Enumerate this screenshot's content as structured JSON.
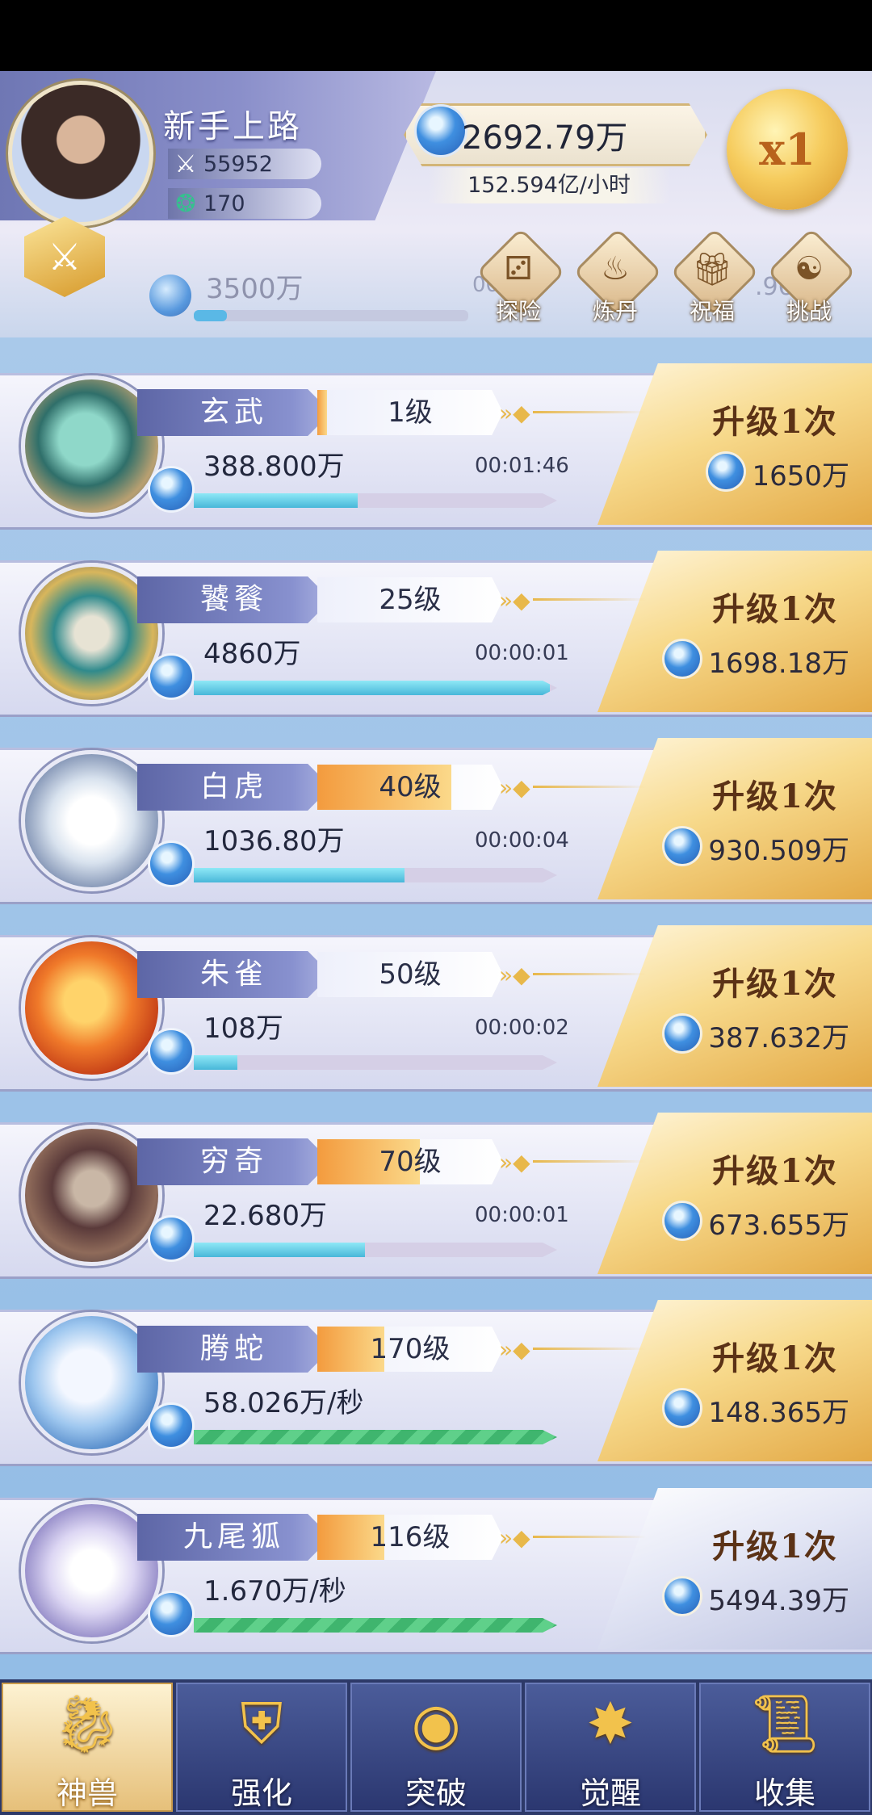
{
  "player": {
    "name": "新手上路",
    "power": "55952",
    "jade": "170",
    "coins": "2692.79万",
    "rate": "152.594亿/小时",
    "speed": "x1"
  },
  "hidden_row": {
    "amount": "3500万",
    "timer_fragment": "00:0",
    "right_fragment": ".96"
  },
  "actions": [
    {
      "label": "探险",
      "icon": "dice-icon"
    },
    {
      "label": "炼丹",
      "icon": "cauldron-icon"
    },
    {
      "label": "祝福",
      "icon": "gift-icon"
    },
    {
      "label": "挑战",
      "icon": "challenge-icon"
    }
  ],
  "beasts": [
    {
      "name": "玄武",
      "level": "1级",
      "level_progress": 0.05,
      "output": "388.800万",
      "timer": "00:01:46",
      "progress": 0.45,
      "upgrade_label": "升级1次",
      "cost": "1650万",
      "auto": false
    },
    {
      "name": "饕餮",
      "level": "25级",
      "level_progress": 0.0,
      "output": "4860万",
      "timer": "00:00:01",
      "progress": 0.98,
      "upgrade_label": "升级1次",
      "cost": "1698.18万",
      "auto": false
    },
    {
      "name": "白虎",
      "level": "40级",
      "level_progress": 0.72,
      "output": "1036.80万",
      "timer": "00:00:04",
      "progress": 0.58,
      "upgrade_label": "升级1次",
      "cost": "930.509万",
      "auto": false
    },
    {
      "name": "朱雀",
      "level": "50级",
      "level_progress": 0.0,
      "output": "108万",
      "timer": "00:00:02",
      "progress": 0.12,
      "upgrade_label": "升级1次",
      "cost": "387.632万",
      "auto": false
    },
    {
      "name": "穷奇",
      "level": "70级",
      "level_progress": 0.55,
      "output": "22.680万",
      "timer": "00:00:01",
      "progress": 0.47,
      "upgrade_label": "升级1次",
      "cost": "673.655万",
      "auto": false
    },
    {
      "name": "腾蛇",
      "level": "170级",
      "level_progress": 0.36,
      "output": "58.026万/秒",
      "timer": "",
      "progress": 1.0,
      "upgrade_label": "升级1次",
      "cost": "148.365万",
      "auto": true
    },
    {
      "name": "九尾狐",
      "level": "116级",
      "level_progress": 0.36,
      "output": "1.670万/秒",
      "timer": "",
      "progress": 1.0,
      "upgrade_label": "升级1次",
      "cost": "5494.39万",
      "auto": true
    }
  ],
  "nav": [
    {
      "label": "神兽",
      "icon": "qilin-icon",
      "active": true
    },
    {
      "label": "强化",
      "icon": "helmet-icon",
      "active": false
    },
    {
      "label": "突破",
      "icon": "flame-orb-icon",
      "active": false
    },
    {
      "label": "觉醒",
      "icon": "eye-icon",
      "active": false
    },
    {
      "label": "收集",
      "icon": "scroll-icon",
      "active": false
    }
  ],
  "colors": {
    "gold": "#f7d98b",
    "nav_bg": "#2d3968",
    "progress": "#48b7d9"
  }
}
